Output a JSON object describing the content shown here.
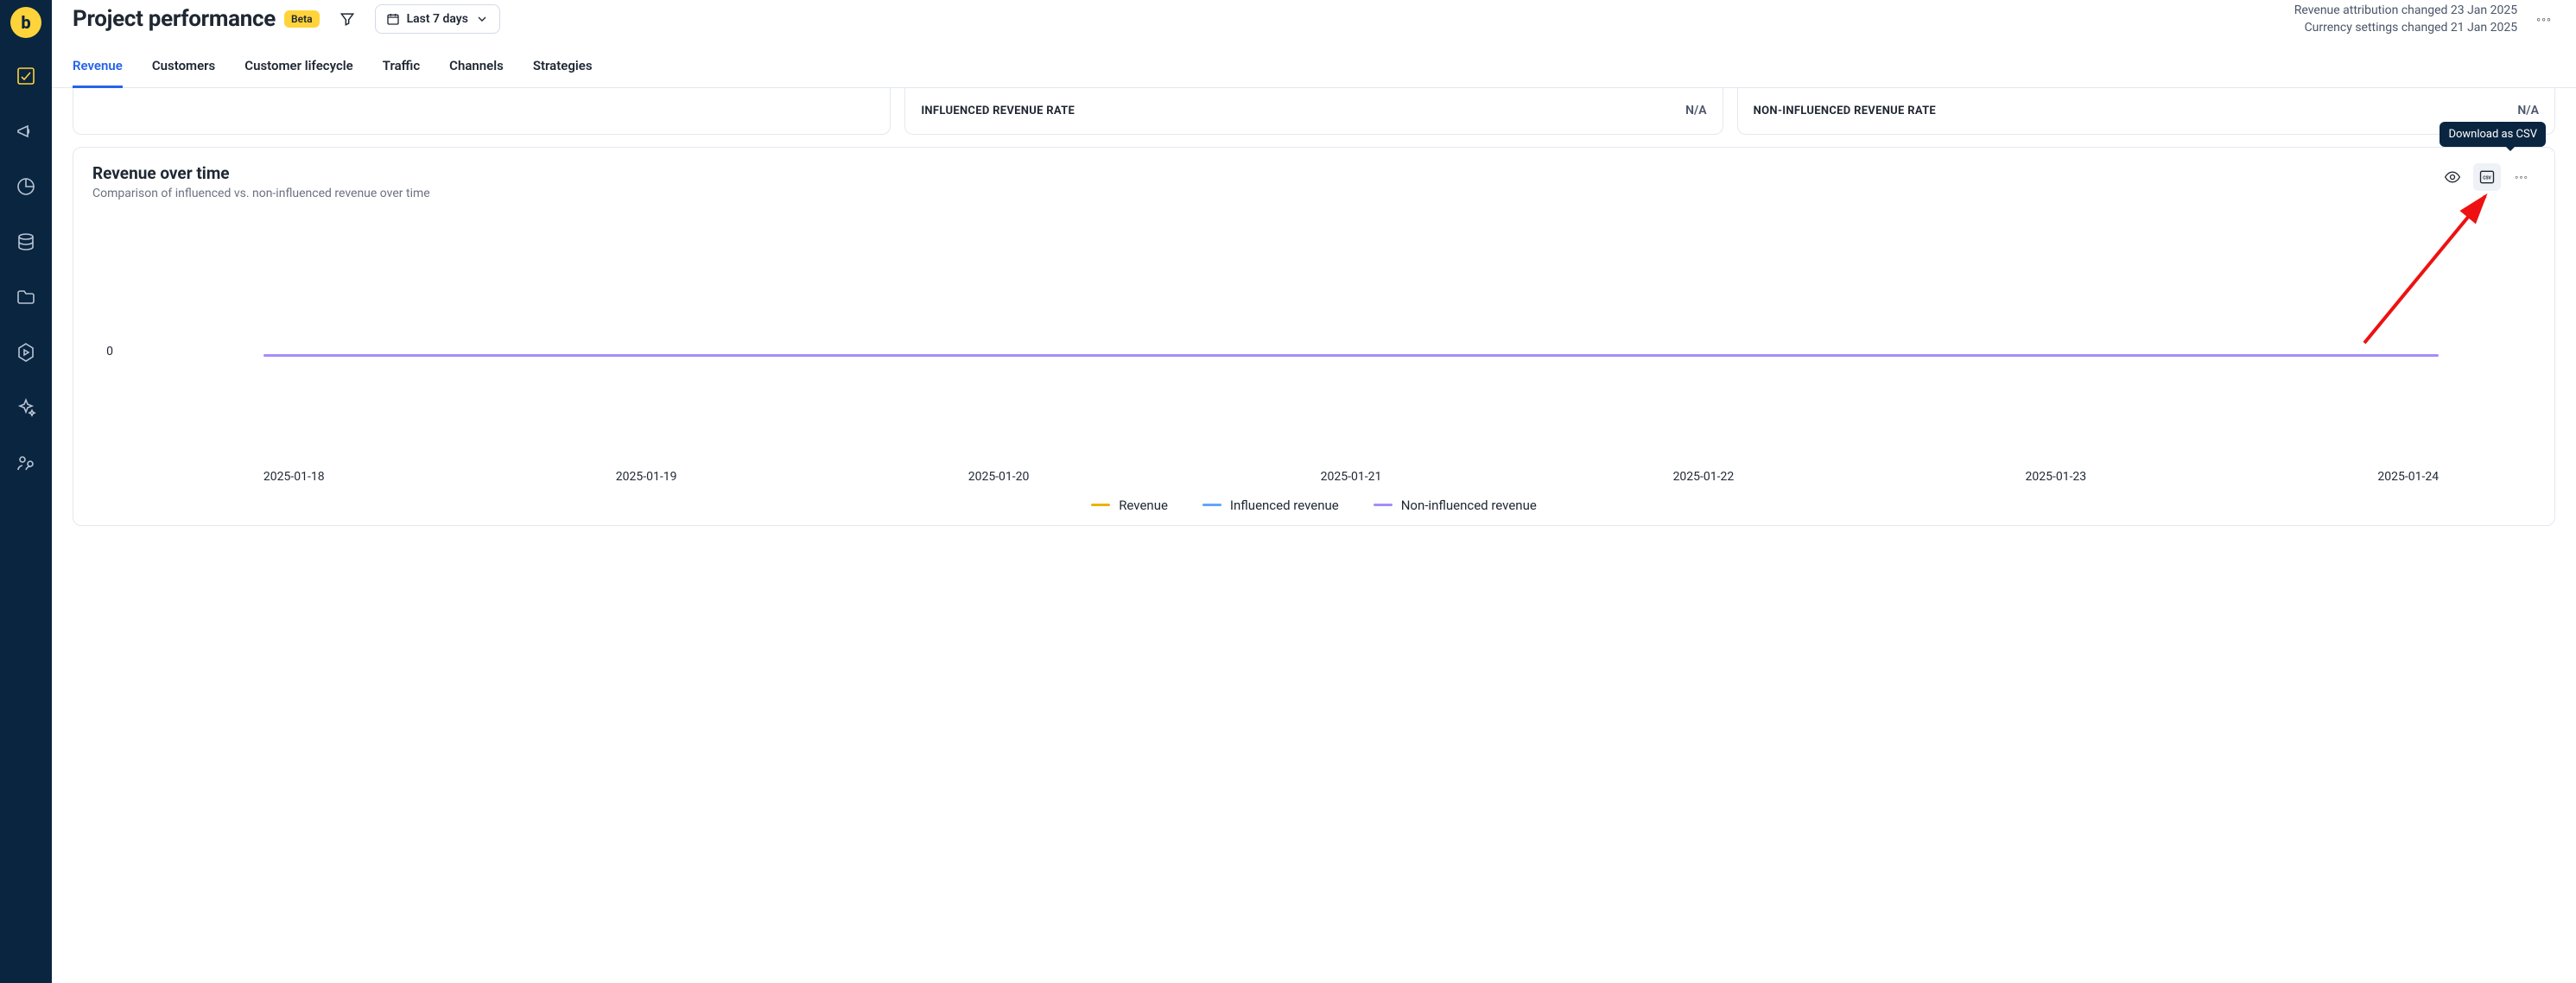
{
  "sidebar": {
    "logo_text": "b",
    "items": [
      {
        "name": "dashboard",
        "active": true
      },
      {
        "name": "campaigns"
      },
      {
        "name": "analytics"
      },
      {
        "name": "data"
      },
      {
        "name": "files"
      },
      {
        "name": "playground"
      },
      {
        "name": "ai"
      },
      {
        "name": "team"
      }
    ]
  },
  "header": {
    "title": "Project performance",
    "badge": "Beta",
    "date_range_label": "Last 7 days",
    "changes": {
      "line1": "Revenue attribution changed 23 Jan 2025",
      "line2": "Currency settings changed 21 Jan 2025"
    }
  },
  "tabs": [
    {
      "label": "Revenue",
      "active": true
    },
    {
      "label": "Customers"
    },
    {
      "label": "Customer lifecycle"
    },
    {
      "label": "Traffic"
    },
    {
      "label": "Channels"
    },
    {
      "label": "Strategies"
    }
  ],
  "kpi_cards": [
    {
      "label": "",
      "value": ""
    },
    {
      "label": "INFLUENCED REVENUE RATE",
      "value": "N/A"
    },
    {
      "label": "NON-INFLUENCED REVENUE RATE",
      "value": "N/A"
    }
  ],
  "chart": {
    "title": "Revenue over time",
    "subtitle": "Comparison of influenced vs. non-influenced revenue over time",
    "tooltip": "Download as CSV",
    "ytick0": "0",
    "legend": {
      "rev": "Revenue",
      "inf": "Influenced revenue",
      "non": "Non-influenced revenue"
    }
  },
  "chart_data": {
    "type": "line",
    "title": "Revenue over time",
    "xlabel": "",
    "ylabel": "",
    "ylim": [
      0,
      0
    ],
    "categories": [
      "2025-01-18",
      "2025-01-19",
      "2025-01-20",
      "2025-01-21",
      "2025-01-22",
      "2025-01-23",
      "2025-01-24"
    ],
    "series": [
      {
        "name": "Revenue",
        "color": "#eab308",
        "values": [
          0,
          0,
          0,
          0,
          0,
          0,
          0
        ]
      },
      {
        "name": "Influenced revenue",
        "color": "#60a5fa",
        "values": [
          0,
          0,
          0,
          0,
          0,
          0,
          0
        ]
      },
      {
        "name": "Non-influenced revenue",
        "color": "#a78bfa",
        "values": [
          0,
          0,
          0,
          0,
          0,
          0,
          0
        ]
      }
    ]
  }
}
